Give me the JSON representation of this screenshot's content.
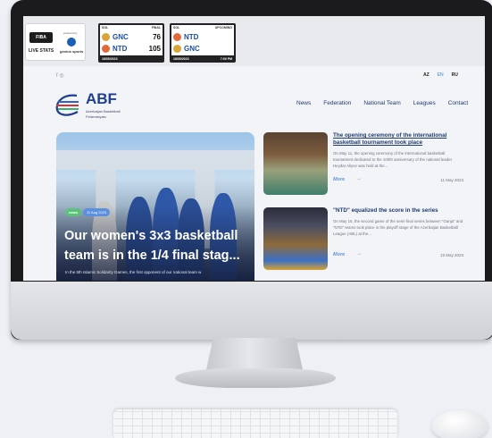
{
  "scorebar": {
    "live_label": "LIVE STATS",
    "fiba_label": "FIBA",
    "powered_by": "powered by",
    "genius_label": "genius sports",
    "games": [
      {
        "left_label": "SOL",
        "right_label": "FINAL",
        "team1": {
          "name": "GNC",
          "score": "76"
        },
        "team2": {
          "name": "NTD",
          "score": "105"
        },
        "date": "18/05/2023",
        "time": ""
      },
      {
        "left_label": "SOL",
        "right_label": "UPCOMING",
        "team1": {
          "name": "NTD",
          "score": ""
        },
        "team2": {
          "name": "GNC",
          "score": ""
        },
        "date": "18/05/2023",
        "time": "7:00 PM"
      }
    ]
  },
  "social": "f ◎",
  "langs": [
    "AZ",
    "EN",
    "RU"
  ],
  "brand": {
    "title": "ABF",
    "subtitle": "Azerbaijan Basketball Federasiyası"
  },
  "nav": [
    "News",
    "Federation",
    "National Team",
    "Leagues",
    "Contact"
  ],
  "hero": {
    "tag": "news",
    "date": "11 Aug 2023",
    "title": "Our women's 3x3 basketball team is in the 1/4 final stag...",
    "text": "In the 5th Islamic Solidarity Games, the first opponent of our national team w"
  },
  "news": [
    {
      "title": "The opening ceremony of the international basketball tournament took place",
      "text": "On May 11, the opening ceremony of the international basketball tournament dedicated to the 100th anniversary of the national leader Heydar Aliyev was held at the...",
      "more": "More",
      "date": "11 May 2023"
    },
    {
      "title": "\"NTD\" equalized the score in the series",
      "text": "On May 15, the second game of the semi-final series between \"Ganja\" and \"NTD\" teams took place in the playoff stage of the Azerbaijan Basketball League (ABL) at the...",
      "more": "More",
      "date": "15 May 2023"
    }
  ],
  "colors": {
    "brand": "#1e3f8f",
    "accent": "#5f93d6",
    "news_tag": "#5cc27b"
  }
}
